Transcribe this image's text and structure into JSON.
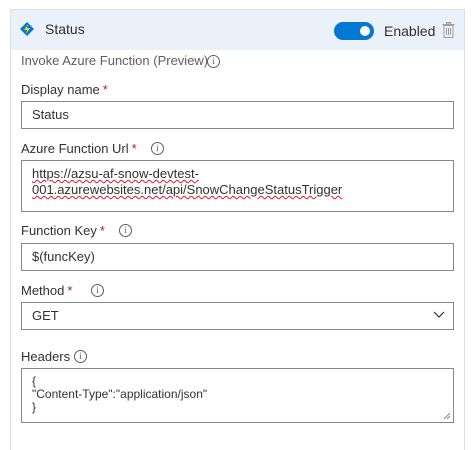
{
  "header": {
    "title": "Status",
    "toggle_label": "Enabled",
    "toggle_on": true
  },
  "action": {
    "subtitle": "Invoke Azure Function (Preview)"
  },
  "fields": {
    "display_name": {
      "label": "Display name",
      "required": "*",
      "value": "Status"
    },
    "function_url": {
      "label": "Azure Function Url",
      "required": "*",
      "value_line1": "https://azsu-af-snow-devtest-",
      "value_line2": "001.azurewebsites.net/api/SnowChangeStatusTrigger"
    },
    "function_key": {
      "label": "Function Key",
      "required": "*",
      "value": "$(funcKey)"
    },
    "method": {
      "label": "Method",
      "required": "*",
      "value": "GET"
    },
    "headers": {
      "label": "Headers",
      "line1": "{",
      "line2": "\"Content-Type\":\"application/json\"",
      "line3": "}"
    }
  },
  "info_glyph": "i",
  "colors": {
    "accent": "#0078d4",
    "header_bg": "#eaf1fb",
    "required": "#a4262c",
    "border": "#8a8886"
  }
}
